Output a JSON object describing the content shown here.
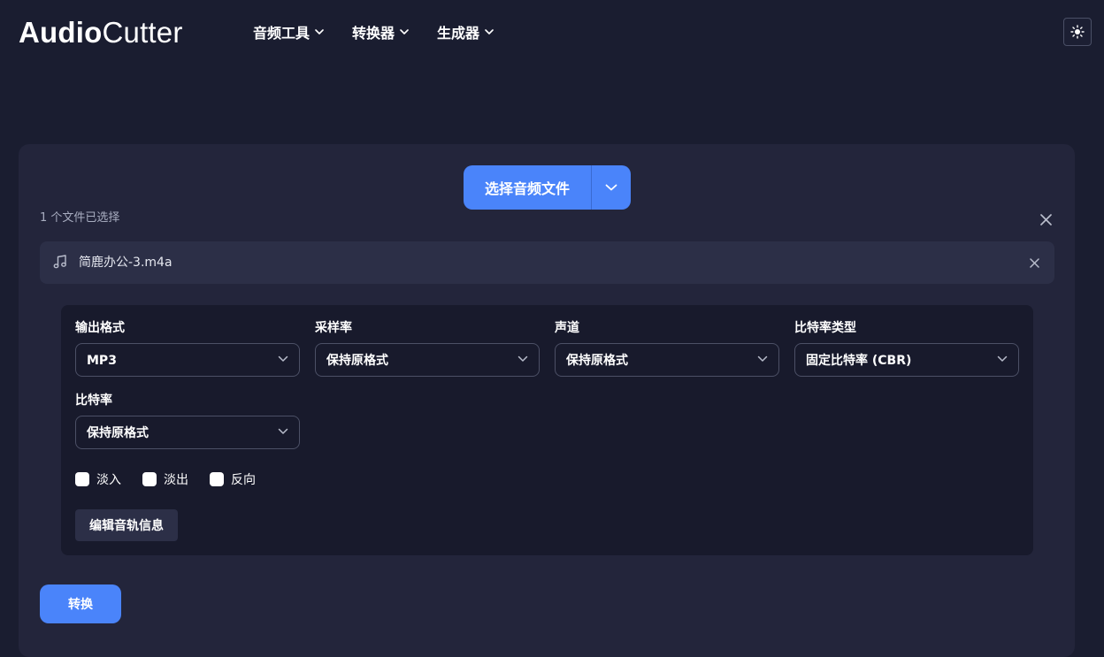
{
  "brand": {
    "name_bold": "Audio",
    "name_light": "Cutter"
  },
  "nav": {
    "items": [
      {
        "label": "音频工具"
      },
      {
        "label": "转换器"
      },
      {
        "label": "生成器"
      }
    ]
  },
  "header": {
    "theme_icon": "sun-icon"
  },
  "upload": {
    "pick_label": "选择音频文件",
    "selected_count": "1 个文件已选择",
    "files": [
      {
        "name": "简鹿办公-3.m4a",
        "icon": "music-note-icon"
      }
    ]
  },
  "options": {
    "format": {
      "label": "输出格式",
      "value": "MP3"
    },
    "sample_rate": {
      "label": "采样率",
      "value": "保持原格式"
    },
    "channels": {
      "label": "声道",
      "value": "保持原格式"
    },
    "bitrate_type": {
      "label": "比特率类型",
      "value": "固定比特率 (CBR)"
    },
    "bitrate": {
      "label": "比特率",
      "value": "保持原格式"
    },
    "checkboxes": [
      {
        "label": "淡入",
        "checked": false
      },
      {
        "label": "淡出",
        "checked": false
      },
      {
        "label": "反向",
        "checked": false
      }
    ],
    "edit_meta_label": "编辑音轨信息"
  },
  "actions": {
    "convert_label": "转换"
  },
  "colors": {
    "accent": "#4a84fa",
    "background": "#1a1d30",
    "card": "#23253b",
    "panel": "#181a2c"
  }
}
